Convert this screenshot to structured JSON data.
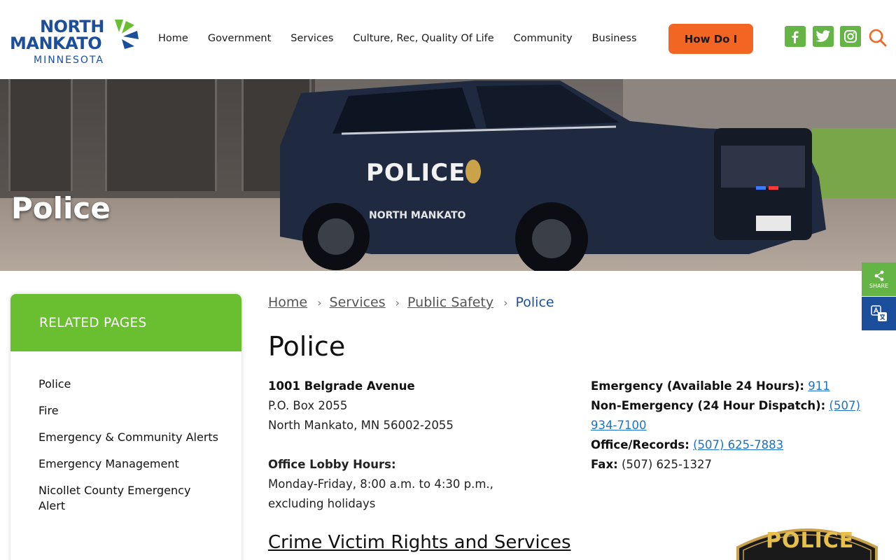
{
  "logo": {
    "line1": "NORTH",
    "line2": "MANKATO",
    "line3": "MINNESOTA"
  },
  "nav": {
    "items": [
      "Home",
      "Government",
      "Services",
      "Culture, Rec, Quality Of Life",
      "Community",
      "Business"
    ],
    "cta": "How Do I"
  },
  "icons": {
    "facebook": "facebook-icon",
    "twitter": "twitter-icon",
    "instagram": "instagram-icon",
    "search": "search-icon",
    "share": "share-icon",
    "translate": "translate-icon"
  },
  "colors": {
    "brand_blue": "#1b4f9c",
    "brand_green": "#64b446",
    "sidebar_green": "#6abf30",
    "cta_orange": "#f26522",
    "link_blue": "#1a73c8"
  },
  "hero": {
    "title": "Police",
    "car_text": "POLICE",
    "car_subtext": "NORTH MANKATO"
  },
  "share": {
    "label": "SHARE"
  },
  "sidebar": {
    "heading": "RELATED PAGES",
    "items": [
      "Police",
      "Fire",
      "Emergency & Community Alerts",
      "Emergency Management",
      "Nicollet County Emergency Alert"
    ]
  },
  "breadcrumb": {
    "items": [
      "Home",
      "Services",
      "Public Safety"
    ],
    "current": "Police"
  },
  "main": {
    "title": "Police",
    "address": {
      "street": "1001 Belgrade Avenue",
      "po_box": "P.O. Box 2055",
      "city": "North Mankato, MN 56002-2055"
    },
    "hours": {
      "label": "Office Lobby Hours:",
      "value": "Monday-Friday, 8:00 a.m. to 4:30 p.m., excluding holidays"
    },
    "contacts": {
      "emergency_label": "Emergency (Available 24 Hours):",
      "emergency_value": "911",
      "nonemergency_label": "Non-Emergency (24 Hour Dispatch):",
      "nonemergency_value": "(507) 934-7100",
      "office_label": "Office/Records:",
      "office_value": "(507) 625-7883",
      "fax_label": "Fax:",
      "fax_value": "(507) 625-1327"
    },
    "section_title": "Crime Victim Rights and Services",
    "badge_text": "POLICE"
  }
}
